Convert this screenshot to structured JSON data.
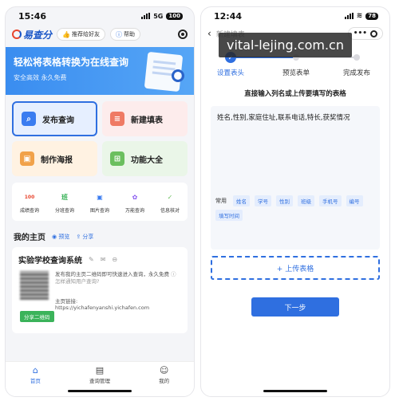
{
  "left": {
    "status": {
      "time": "15:46",
      "network": "5G",
      "battery": "100"
    },
    "header": {
      "logo_text": "易查分",
      "invite_label": "推荐给好友",
      "help_label": "帮助"
    },
    "banner": {
      "title": "轻松将表格转换为在线查询",
      "subtitle": "安全高效 永久免费"
    },
    "tiles": [
      {
        "label": "发布查询",
        "icon": "search-doc-icon",
        "color": "#3a7cf0"
      },
      {
        "label": "新建填表",
        "icon": "form-icon",
        "color": "#ef7a64"
      },
      {
        "label": "制作海报",
        "icon": "image-icon",
        "color": "#f1a24a"
      },
      {
        "label": "功能大全",
        "icon": "apps-icon",
        "color": "#6bbf5f"
      }
    ],
    "tools": [
      {
        "label": "成绩查询",
        "glyph": "100",
        "color": "#e8452e"
      },
      {
        "label": "分班查询",
        "glyph": "班",
        "color": "#3bb35a"
      },
      {
        "label": "图片查询",
        "glyph": "▣",
        "color": "#3a7cf0"
      },
      {
        "label": "万能查询",
        "glyph": "✿",
        "color": "#8a5cf0"
      },
      {
        "label": "信息核对",
        "glyph": "✓",
        "color": "#6bbf5f"
      }
    ],
    "home": {
      "title": "我的主页",
      "preview": "◉ 预览",
      "share": "⇪ 分享"
    },
    "card": {
      "title": "实验学校查询系统",
      "desc": "发布我的主页二维码即可快速进入查询，永久免费",
      "help": "怎样通知用户查询?",
      "link_label": "主页链接:",
      "link": "https://yichafenyanshi.yichafen.com",
      "share_button": "分享二维码"
    },
    "tabbar": [
      {
        "label": "首页",
        "icon": "home-icon",
        "active": true
      },
      {
        "label": "查询管理",
        "icon": "manage-icon",
        "active": false
      },
      {
        "label": "我的",
        "icon": "user-icon",
        "active": false
      }
    ]
  },
  "right": {
    "status": {
      "time": "12:44",
      "battery": "78"
    },
    "nav": {
      "title": "新建填表"
    },
    "watermark": "vital-lejing.com.cn",
    "steps": [
      "设置表头",
      "预览表单",
      "完成发布"
    ],
    "instruction": "直接输入列名或上传要填写的表格",
    "input_text": "姓名,性别,家庭住址,联系电话,特长,获奖情况",
    "common_label": "常用",
    "chips": [
      "姓名",
      "学号",
      "性别",
      "班级",
      "手机号",
      "编号",
      "填写时间"
    ],
    "upload_label": "+ 上传表格",
    "next_label": "下一步"
  }
}
